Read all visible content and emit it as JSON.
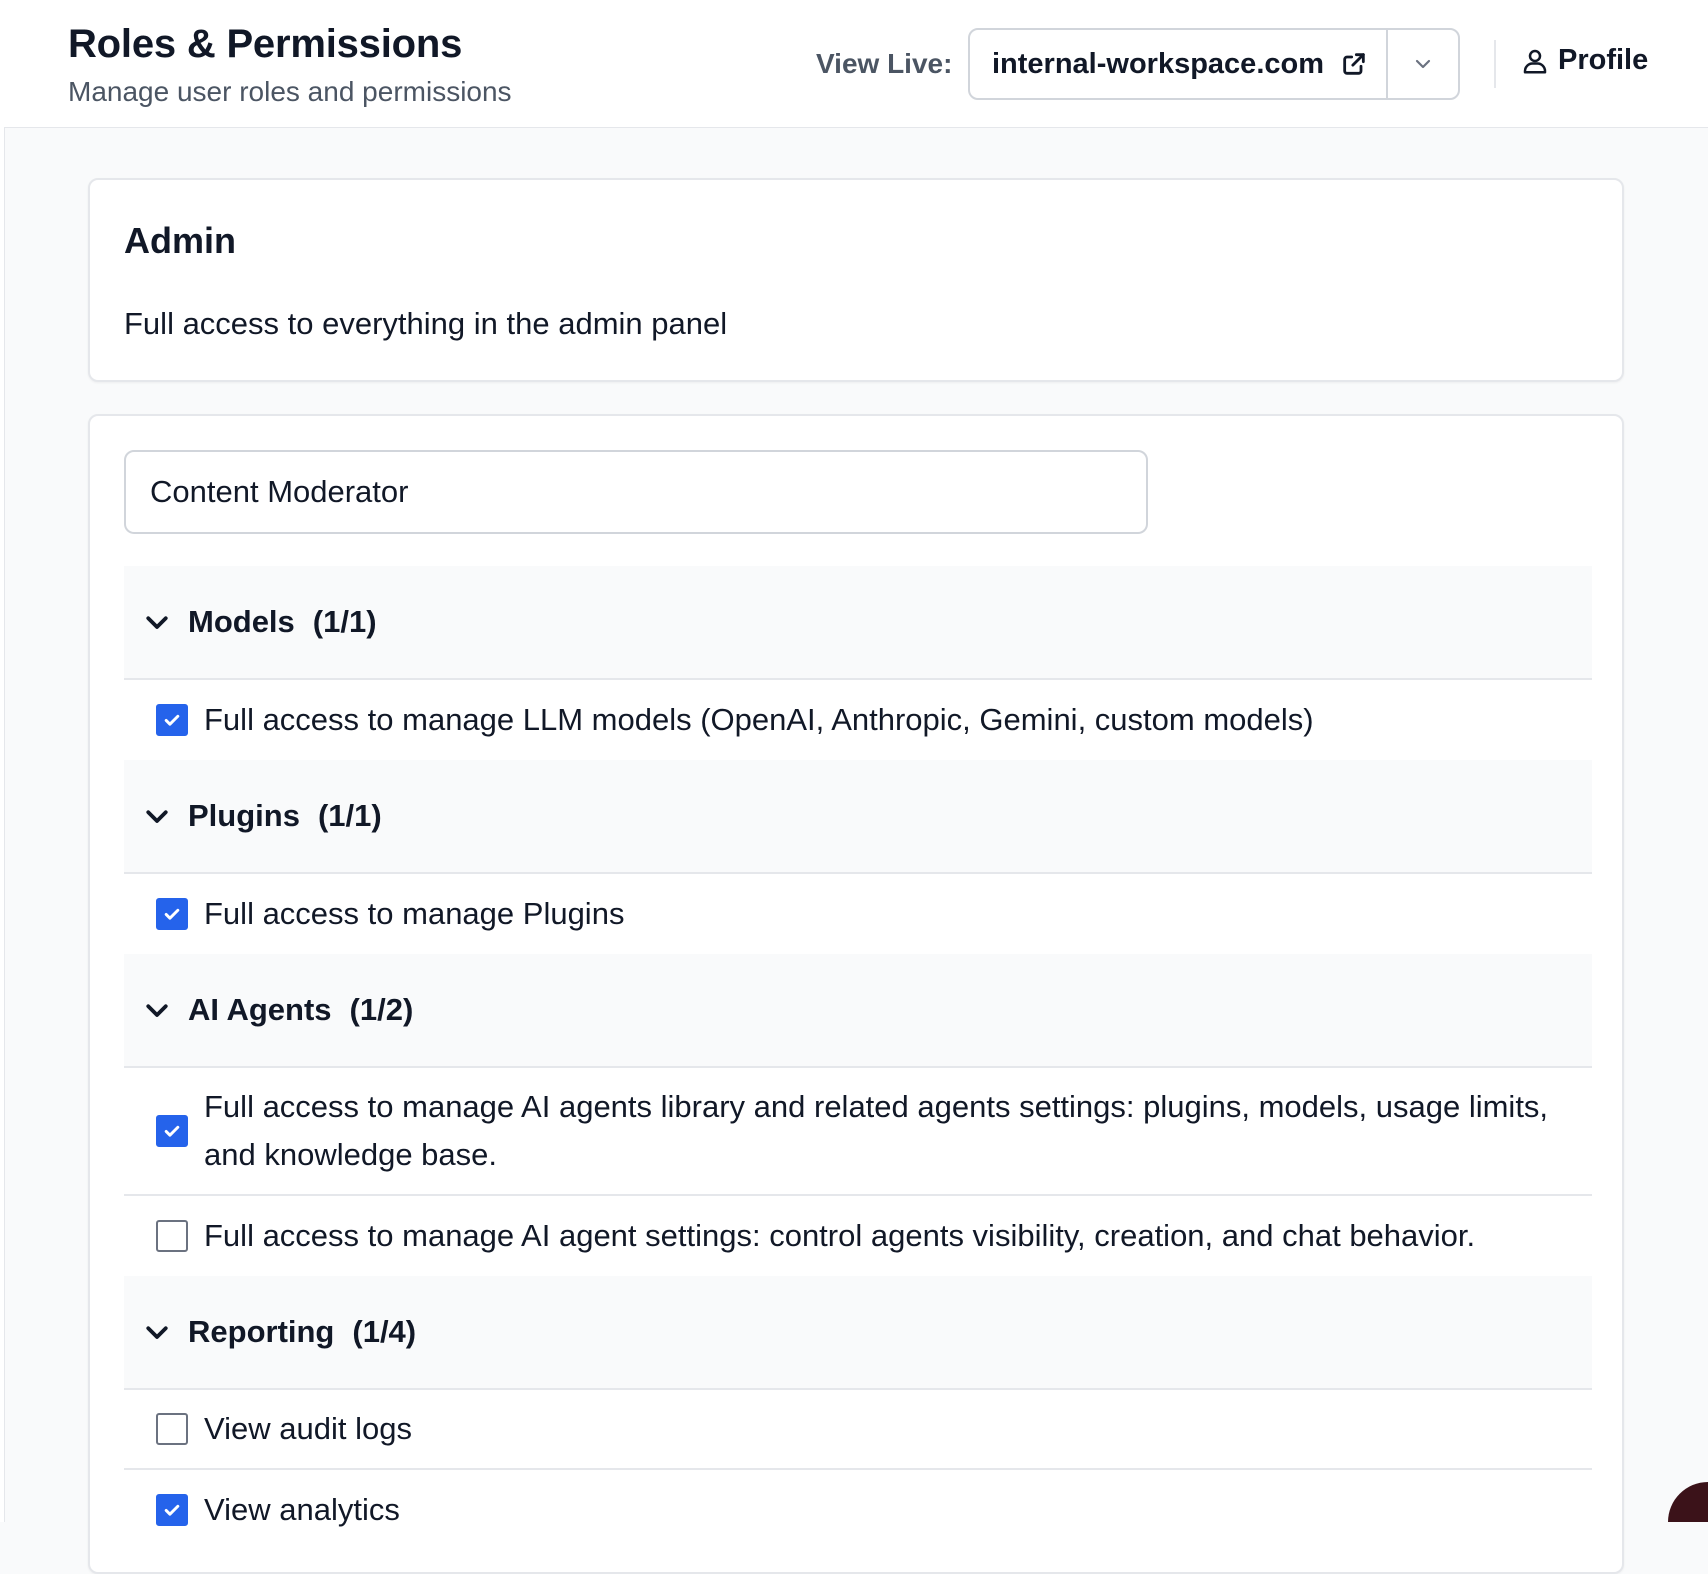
{
  "header": {
    "title": "Roles & Permissions",
    "subtitle": "Manage user roles and permissions",
    "view_live_label": "View Live:",
    "live_domain": "internal-workspace.com",
    "profile_label": "Profile"
  },
  "admin_role": {
    "name": "Admin",
    "description": "Full access to everything in the admin panel"
  },
  "edit_role": {
    "name_value": "Content Moderator",
    "groups": [
      {
        "title": "Models",
        "count": "(1/1)",
        "permissions": [
          {
            "label": "Full access to manage LLM models (OpenAI, Anthropic, Gemini, custom models)",
            "checked": true
          }
        ]
      },
      {
        "title": "Plugins",
        "count": "(1/1)",
        "permissions": [
          {
            "label": "Full access to manage Plugins",
            "checked": true
          }
        ]
      },
      {
        "title": "AI Agents",
        "count": "(1/2)",
        "permissions": [
          {
            "label": "Full access to manage AI agents library and related agents settings: plugins, models, usage limits, and knowledge base.",
            "checked": true
          },
          {
            "label": "Full access to manage AI agent settings: control agents visibility, creation, and chat behavior.",
            "checked": false
          }
        ]
      },
      {
        "title": "Reporting",
        "count": "(1/4)",
        "permissions": [
          {
            "label": "View audit logs",
            "checked": false
          },
          {
            "label": "View analytics",
            "checked": true
          }
        ]
      }
    ]
  },
  "colors": {
    "accent": "#2563eb",
    "border": "#e5e7eb",
    "muted_text": "#4b5563"
  },
  "icons": {
    "external_link": "external-link-icon",
    "chevron_down": "chevron-down-icon",
    "user": "user-icon",
    "check": "check-icon"
  }
}
